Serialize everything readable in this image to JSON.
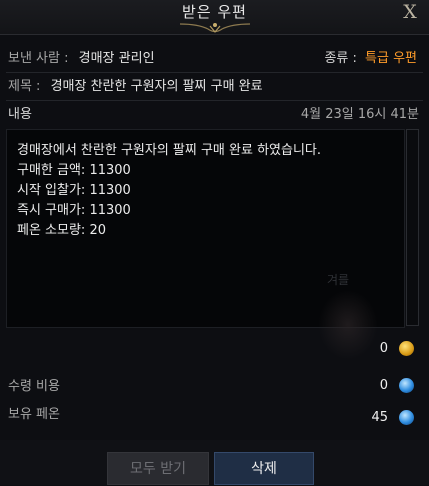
{
  "window": {
    "title": "받은 우편",
    "close_glyph": "X"
  },
  "sender": {
    "label": "보낸 사람 :",
    "value": "경매장 관리인"
  },
  "type": {
    "label": "종류 :",
    "value": "특급 우편"
  },
  "subject": {
    "label": "제목 :",
    "value": "경매장 찬란한 구원자의 팔찌 구매 완료"
  },
  "content": {
    "label": "내용",
    "timestamp": "4월 23일 16시 41분"
  },
  "body_lines": [
    "경매장에서 찬란한 구원자의 팔찌 구매 완료 하였습니다.",
    "구매한 금액: 11300",
    "시작 입찰가: 11300",
    "즉시 구매가: 11300",
    "페온 소모량: 20"
  ],
  "watermark": "겨를",
  "attached_gold": {
    "value": "0",
    "icon": "gold-coin-icon"
  },
  "receive_cost": {
    "label": "수령 비용",
    "value": "0",
    "icon": "pheon-icon"
  },
  "owned_pheon": {
    "label": "보유 페온",
    "value": "45",
    "icon": "pheon-icon"
  },
  "buttons": {
    "receive_all": "모두 받기",
    "delete": "삭제"
  },
  "colors": {
    "accent_orange": "#ff9c2a",
    "delete_button": "#1f2e45",
    "disabled_button": "#2a2b30"
  }
}
